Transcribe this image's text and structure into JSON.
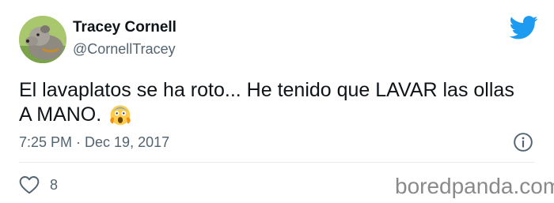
{
  "tweet": {
    "author_name": "Tracey Cornell",
    "author_handle": "@CornellTracey",
    "text": "El lavaplatos se ha roto... He tenido que LAVAR las ollas A MANO.",
    "emoji_icon": "screaming-face-icon",
    "timestamp": "7:25 PM · Dec 19, 2017",
    "like_count": "8"
  },
  "icons": {
    "platform": "twitter-bird-icon",
    "info": "info-icon",
    "like": "heart-icon"
  },
  "watermark": "boredpanda.com",
  "colors": {
    "twitter_blue": "#1d9bf0",
    "secondary_text": "#536471",
    "primary_text": "#0f1419"
  }
}
